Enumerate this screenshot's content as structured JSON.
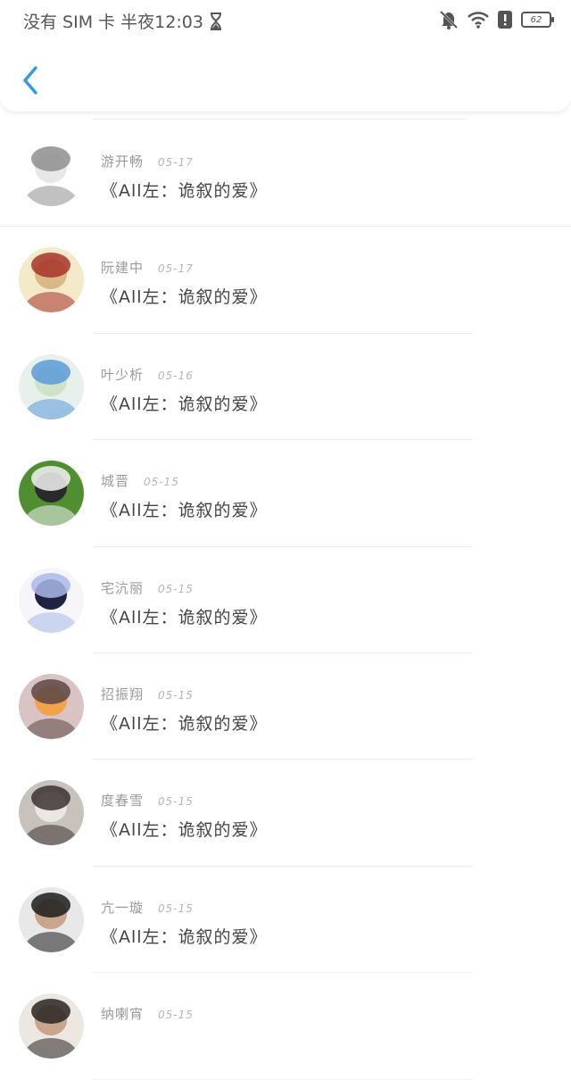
{
  "status_bar": {
    "carrier_time": "没有 SIM 卡 半夜12:03",
    "battery": "62",
    "hourglass_icon": "hourglass-icon",
    "bell_off_icon": "bell-off-icon",
    "wifi_icon": "wifi-icon",
    "alert_icon": "alert-icon"
  },
  "header": {
    "back_icon": "chevron-left-icon",
    "accent": "#2f9ae8"
  },
  "items": [
    {
      "name": "游开畅",
      "date": "05-17",
      "title": "《All左：诡叙的爱》",
      "avatar_colors": [
        "#ffffff",
        "#8e8e8e",
        "#e8e8e8"
      ]
    },
    {
      "name": "阮建中",
      "date": "05-17",
      "title": "《All左：诡叙的爱》",
      "avatar_colors": [
        "#f4e9c8",
        "#a6322a",
        "#d9b986"
      ]
    },
    {
      "name": "叶少析",
      "date": "05-16",
      "title": "《All左：诡叙的爱》",
      "avatar_colors": [
        "#e7f0ea",
        "#5a9bd8",
        "#cfe3c9"
      ]
    },
    {
      "name": "城晋",
      "date": "05-15",
      "title": "《All左：诡叙的爱》",
      "avatar_colors": [
        "#4f8f32",
        "#f2f2f2",
        "#2a2a2a"
      ]
    },
    {
      "name": "宅沆丽",
      "date": "05-15",
      "title": "《All左：诡叙的爱》",
      "avatar_colors": [
        "#f6f6fa",
        "#a9b9e6",
        "#1f2340"
      ]
    },
    {
      "name": "招振翔",
      "date": "05-15",
      "title": "《All左：诡叙的爱》",
      "avatar_colors": [
        "#d9c3c3",
        "#5c4746",
        "#f2a24a"
      ]
    },
    {
      "name": "度春雪",
      "date": "05-15",
      "title": "《All左：诡叙的爱》",
      "avatar_colors": [
        "#c8c2bd",
        "#3b3330",
        "#eae6e2"
      ]
    },
    {
      "name": "亢一璇",
      "date": "05-15",
      "title": "《All左：诡叙的爱》",
      "avatar_colors": [
        "#e8e8e8",
        "#1c1c1c",
        "#c9a58c"
      ]
    },
    {
      "name": "纳喇宵",
      "date": "05-15",
      "title": "",
      "avatar_colors": [
        "#ede7e2",
        "#2a2522",
        "#c9a58c"
      ]
    }
  ]
}
